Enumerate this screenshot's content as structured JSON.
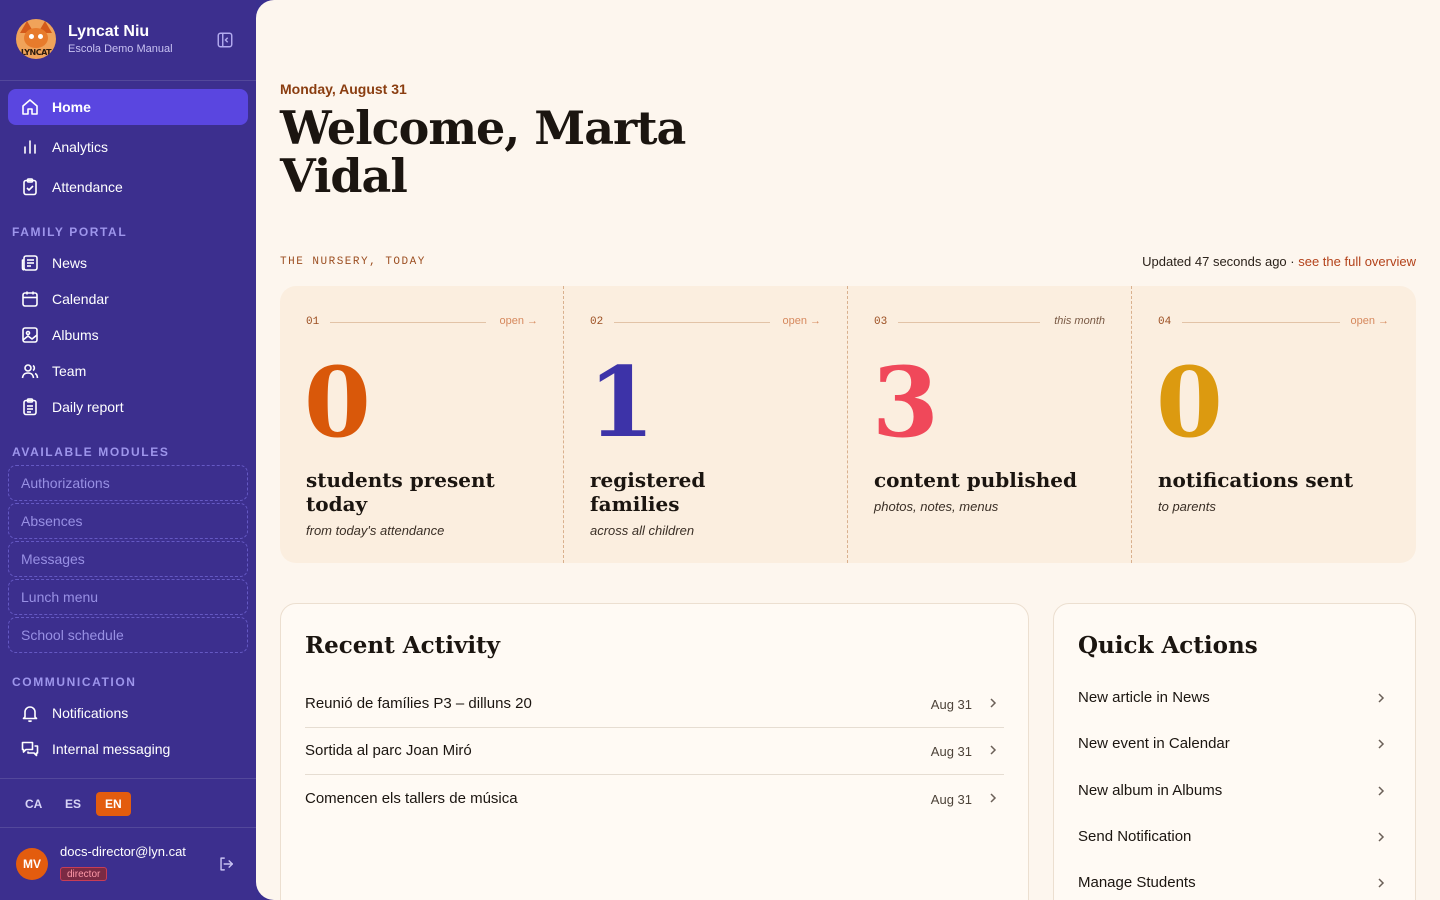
{
  "brand": {
    "name": "Lyncat Niu",
    "subtitle": "Escola Demo Manual",
    "logo_text": "LYNCAT"
  },
  "nav": {
    "main": [
      {
        "label": "Home",
        "icon": "home-icon",
        "active": true
      },
      {
        "label": "Analytics",
        "icon": "bar-chart-icon"
      },
      {
        "label": "Attendance",
        "icon": "clipboard-check-icon"
      }
    ],
    "family_portal_title": "FAMILY PORTAL",
    "family_portal": [
      {
        "label": "News",
        "icon": "newspaper-icon"
      },
      {
        "label": "Calendar",
        "icon": "calendar-icon"
      },
      {
        "label": "Albums",
        "icon": "image-icon"
      },
      {
        "label": "Team",
        "icon": "users-icon"
      },
      {
        "label": "Daily report",
        "icon": "clipboard-list-icon"
      }
    ],
    "modules_title": "AVAILABLE MODULES",
    "modules": [
      "Authorizations",
      "Absences",
      "Messages",
      "Lunch menu",
      "School schedule"
    ],
    "communication_title": "COMMUNICATION",
    "communication": [
      {
        "label": "Notifications",
        "icon": "bell-icon"
      },
      {
        "label": "Internal messaging",
        "icon": "chat-icon"
      }
    ]
  },
  "languages": [
    {
      "code": "CA",
      "active": false
    },
    {
      "code": "ES",
      "active": false
    },
    {
      "code": "EN",
      "active": true
    }
  ],
  "user": {
    "initials": "MV",
    "email": "docs-director@lyn.cat",
    "role": "director"
  },
  "header": {
    "date": "Monday, August 31",
    "welcome_line1": "Welcome, Marta",
    "welcome_line2": "Vidal"
  },
  "overview": {
    "title": "THE NURSERY, TODAY",
    "updated": "Updated 47 seconds ago · ",
    "link": "see the full overview"
  },
  "stats": [
    {
      "num": "01",
      "tag": "open →",
      "value": "0",
      "color": "#d9580a",
      "label": "students present today",
      "sub": "from today's attendance"
    },
    {
      "num": "02",
      "tag": "open →",
      "value": "1",
      "color": "#3d33a8",
      "label": "registered families",
      "sub": "across all children"
    },
    {
      "num": "03",
      "tag": "this month",
      "value": "3",
      "color": "#f0485a",
      "label": "content published",
      "sub": "photos, notes, menus"
    },
    {
      "num": "04",
      "tag": "open →",
      "value": "0",
      "color": "#dc9a10",
      "label": "notifications sent",
      "sub": "to parents"
    }
  ],
  "recent_activity": {
    "title": "Recent Activity",
    "items": [
      {
        "title": "Reunió de famílies P3 – dilluns 20",
        "date": "Aug 31"
      },
      {
        "title": "Sortida al parc Joan Miró",
        "date": "Aug 31"
      },
      {
        "title": "Comencen els tallers de música",
        "date": "Aug 31"
      }
    ]
  },
  "quick_actions": {
    "title": "Quick Actions",
    "items": [
      "New article in News",
      "New event in Calendar",
      "New album in Albums",
      "Send Notification",
      "Manage Students"
    ]
  }
}
